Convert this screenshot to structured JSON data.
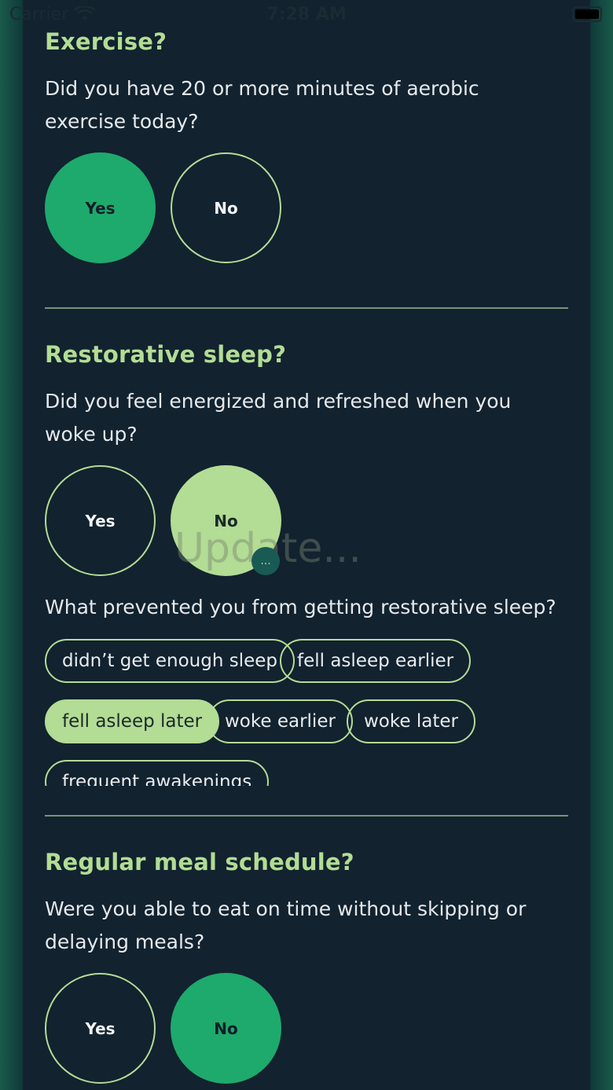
{
  "status_bar": {
    "carrier": "Carrier",
    "time": "7:28 AM"
  },
  "questions": [
    {
      "title": "Exercise?",
      "description": "Did you have 20 or more minutes of aerobic exercise today?",
      "yes": "Yes",
      "no": "No",
      "selected": "yes"
    },
    {
      "title": "Restorative sleep?",
      "description": "Did you feel energized and refreshed when you woke up?",
      "yes": "Yes",
      "no": "No",
      "selected": "no",
      "followup": "What prevented you from getting restorative sleep?",
      "chips": [
        {
          "label": "didn’t get enough sleep",
          "selected": false
        },
        {
          "label": "fell asleep earlier",
          "selected": false
        },
        {
          "label": "fell asleep later",
          "selected": true
        },
        {
          "label": "woke earlier",
          "selected": false
        },
        {
          "label": "woke later",
          "selected": false
        },
        {
          "label": "frequent awakenings",
          "selected": false
        }
      ]
    },
    {
      "title": "Regular meal schedule?",
      "description": "Were you able to eat on time without skipping or delaying meals?",
      "yes": "Yes",
      "no": "No",
      "selected": "no"
    }
  ],
  "watermark": "Update...",
  "overflow_indicator": "...",
  "colors": {
    "background": "#12222f",
    "accent_lime": "#b3dc94",
    "accent_green": "#1eaa6c"
  }
}
